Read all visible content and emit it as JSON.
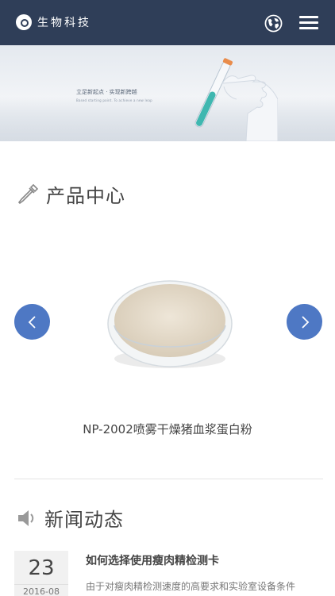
{
  "header": {
    "brand": "生物科技",
    "language_icon": "globe-icon",
    "menu_icon": "hamburger-menu-icon",
    "background": "#2f3e58"
  },
  "banner": {
    "caption": "立足新起点 · 实现新跨越",
    "subcaption": "Based starting point. To achieve a new leap",
    "slides_total": 2,
    "active_slide": 1,
    "dot_active_color": "#1e7de6",
    "dot_inactive_color": "#c8c8c8"
  },
  "products": {
    "title": "产品中心",
    "icon": "dropper-icon",
    "prev_icon": "chevron-left-icon",
    "next_icon": "chevron-right-icon",
    "arrow_color": "#4e78c4",
    "current": {
      "name": "NP-2002喷雾干燥猪血浆蛋白粉"
    }
  },
  "news": {
    "title": "新闻动态",
    "icon": "speaker-icon",
    "items": [
      {
        "day": "23",
        "year_month": "2016-08",
        "title": "如何选择使用瘦肉精检测卡",
        "summary": "由于对瘦肉精检测速度的高要求和实验室设备条件"
      }
    ]
  }
}
